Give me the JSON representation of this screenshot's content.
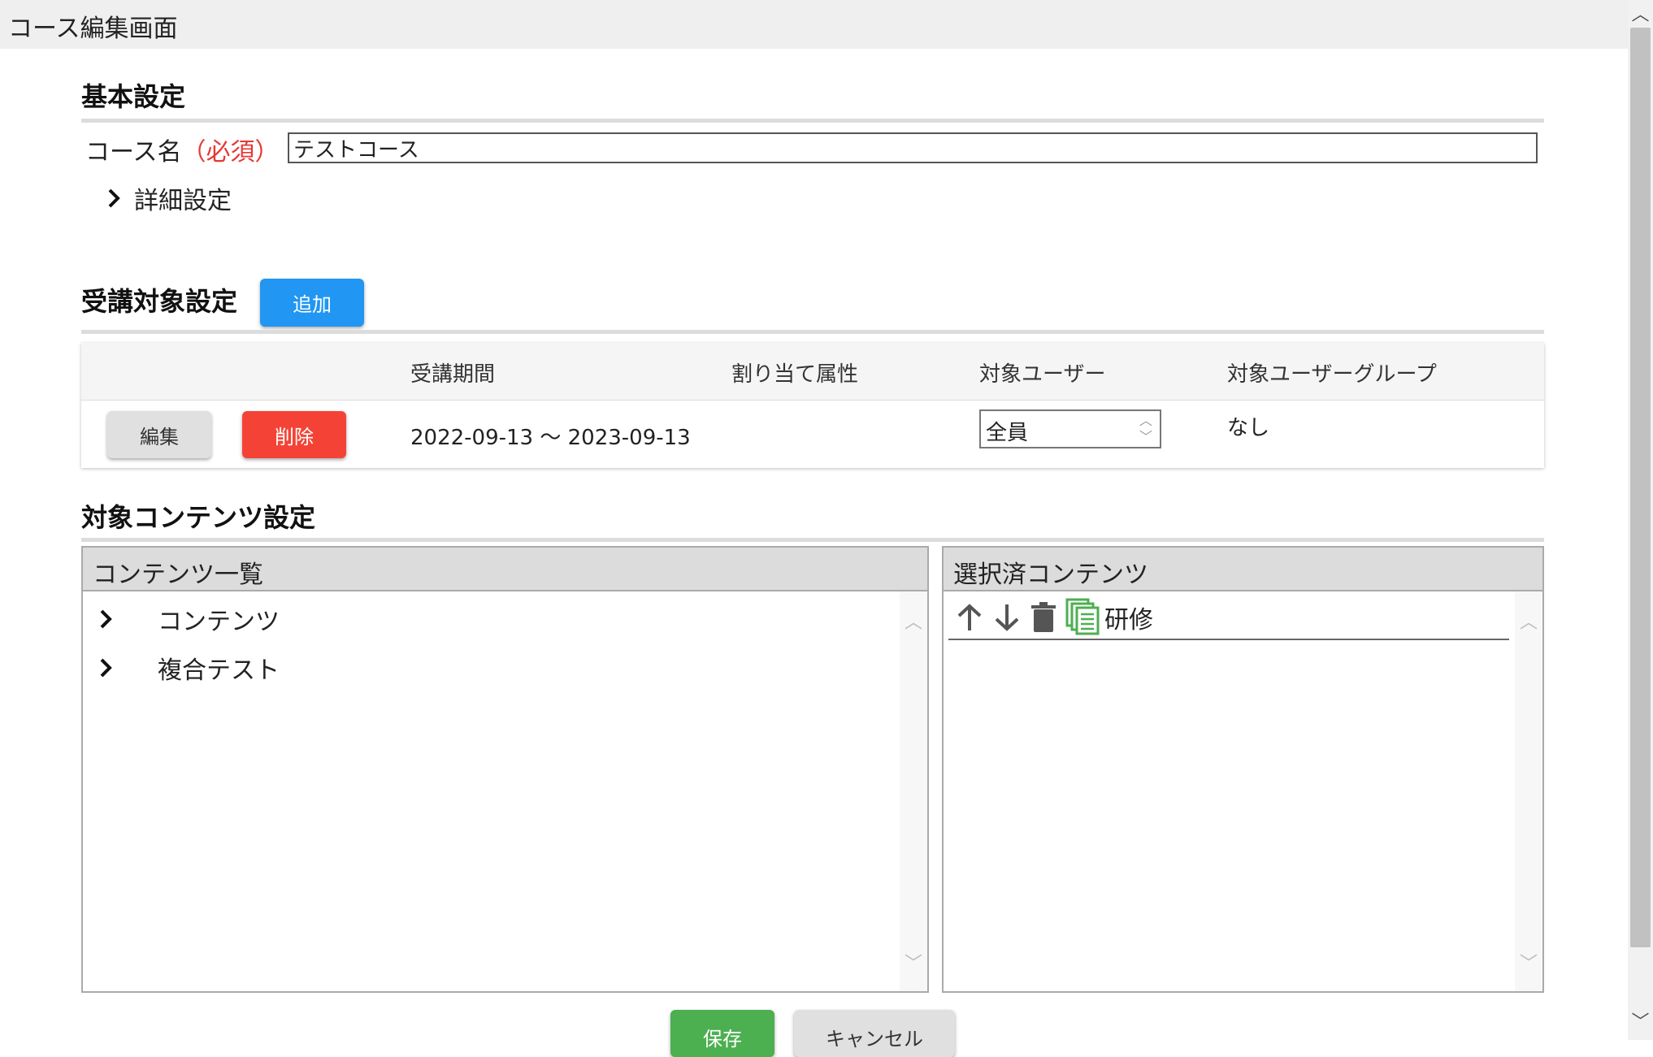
{
  "window": {
    "title": "コース編集画面"
  },
  "basic": {
    "section_title": "基本設定",
    "course_name_label": "コース名",
    "required_label": "（必須）",
    "course_name_value": "テストコース",
    "advanced_label": "詳細設定"
  },
  "target": {
    "section_title": "受講対象設定",
    "add_button": "追加",
    "columns": [
      "受講期間",
      "割り当て属性",
      "対象ユーザー",
      "対象ユーザーグループ"
    ],
    "rows": [
      {
        "edit_button": "編集",
        "delete_button": "削除",
        "period": "2022-09-13 ～ 2023-09-13",
        "attribute": "",
        "user": "全員",
        "user_group": "なし"
      }
    ]
  },
  "contents": {
    "section_title": "対象コンテンツ設定",
    "list_header": "コンテンツ一覧",
    "list_items": [
      "コンテンツ",
      "複合テスト"
    ],
    "selected_header": "選択済コンテンツ",
    "selected_items": [
      {
        "label": "研修",
        "icons": [
          "arrow-up-icon",
          "arrow-down-icon",
          "trash-icon",
          "document-stack-icon"
        ]
      }
    ]
  },
  "footer": {
    "save_button": "保存",
    "cancel_button": "キャンセル"
  },
  "colors": {
    "primary": "#2196f3",
    "danger": "#f44336",
    "success": "#4caf50",
    "neutral": "#e0e0e0",
    "required": "#e53935",
    "doc_icon": "#4caf50"
  }
}
